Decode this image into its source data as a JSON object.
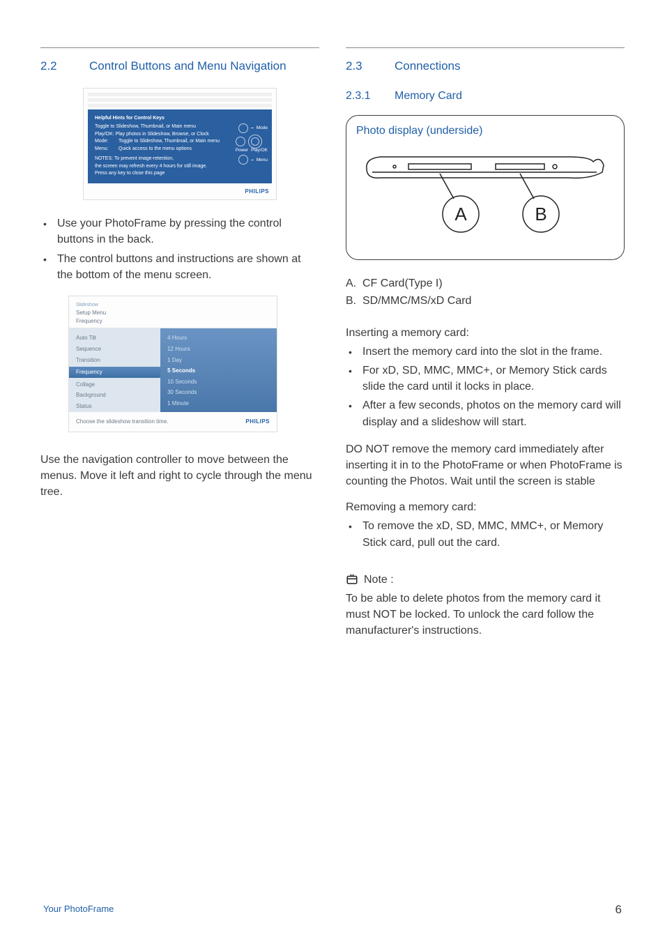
{
  "left": {
    "section_num": "2.2",
    "section_title": "Control Buttons and Menu Navigation",
    "fig1": {
      "header": "Helpful Hints for Control Keys",
      "lines": [
        "Toggle to Slideshow, Thumbnail, or Main menu",
        "Play/OK: Play photos in Slideshow, Browse, or Clock"
      ],
      "kv": [
        {
          "k": "Mode:",
          "v": "Toggle to Slideshow, Thumbnail, or Main menu"
        },
        {
          "k": "Menu:",
          "v": "Quick access to the menu options"
        }
      ],
      "note_hdr": "NOTES: To prevent image-retention,",
      "note_l1": "the screen may refresh every 4 hours for still image.",
      "note_l2": "Press any key to close this page",
      "labels": {
        "mode": "Mode",
        "power": "Power",
        "playok": "Play/OK",
        "menu": "Menu"
      },
      "brand": "PHILIPS"
    },
    "bullets1": [
      "Use your PhotoFrame by pressing the control buttons in the back.",
      "The control buttons and instructions are shown at the bottom of the menu screen."
    ],
    "fig2": {
      "title_small": "Slideshow",
      "title": "Setup Menu",
      "crumb": "Frequency",
      "left_items": [
        "Auto Tilt",
        "Sequence",
        "Transition",
        "Frequency",
        "Collage",
        "Background",
        "Status"
      ],
      "left_highlight_index": 3,
      "right_items": [
        "4 Hours",
        "12 Hours",
        "1 Day",
        "5 Seconds",
        "10 Seconds",
        "30 Seconds",
        "1 Minute"
      ],
      "right_sel_index": 3,
      "caption": "Choose the slideshow transition time.",
      "brand": "PHILIPS"
    },
    "para1": "Use the navigation controller to move between the menus. Move it left  and right  to cycle through the menu tree."
  },
  "right": {
    "section_num": "2.3",
    "section_title": "Connections",
    "sub_num": "2.3.1",
    "sub_title": "Memory  Card",
    "fig3_title": "Photo display (underside)",
    "fig3_labels": {
      "a": "A",
      "b": "B"
    },
    "legend": [
      {
        "k": "A.",
        "v": "CF Card(Type I)"
      },
      {
        "k": "B.",
        "v": "SD/MMC/MS/xD Card"
      }
    ],
    "ins_title": "Inserting a memory card:",
    "ins_bullets": [
      "Insert the memory card into the slot in the frame.",
      "For xD, SD, MMC, MMC+, or Memory Stick cards slide the card until it locks in place.",
      "After a few seconds, photos on the memory card will display and a slideshow will start."
    ],
    "warn": "DO NOT remove the memory card immediately after inserting it in to the PhotoFrame or when PhotoFrame is counting the Photos. Wait until the screen is stable",
    "rem_title": "Removing a memory card:",
    "rem_bullets": [
      "To remove the xD, SD, MMC, MMC+, or Memory Stick card, pull out the card."
    ],
    "note_label": "Note :",
    "note_body": "To be able to delete photos from the memory card it must NOT be locked. To unlock the card follow the manufacturer's instructions."
  },
  "footer": {
    "left": "Your PhotoFrame",
    "page": "6"
  }
}
